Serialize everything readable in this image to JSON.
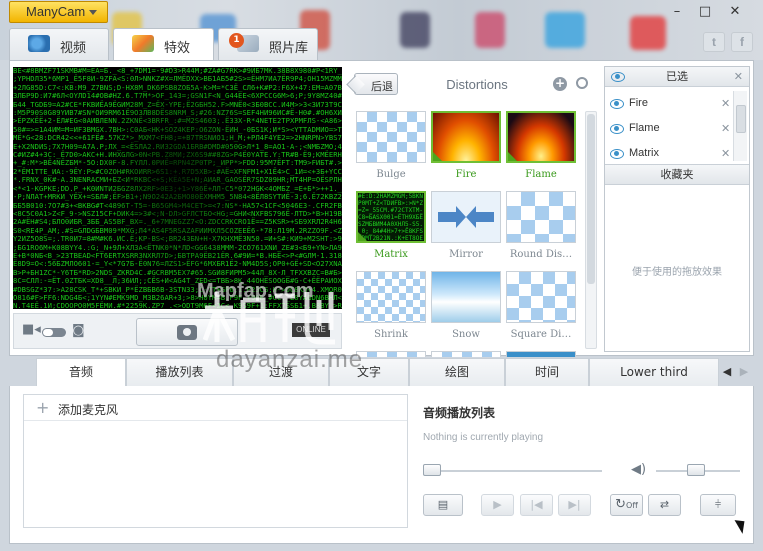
{
  "app": {
    "brand": "ManyCam"
  },
  "window_controls": {
    "min": "–",
    "max": "□",
    "close": "✕"
  },
  "social": {
    "twitter": "t",
    "facebook": "f"
  },
  "main_tabs": [
    {
      "label": "视频"
    },
    {
      "label": "特效"
    },
    {
      "label": "照片库",
      "badge": "1"
    }
  ],
  "effects": {
    "back_label": "后退",
    "category_title": "Distortions",
    "items": [
      {
        "label": "Bulge"
      },
      {
        "label": "Fire"
      },
      {
        "label": "Flame"
      },
      {
        "label": "Matrix"
      },
      {
        "label": "Mirror"
      },
      {
        "label": "Round Dis…"
      },
      {
        "label": "Shrink"
      },
      {
        "label": "Snow"
      },
      {
        "label": "Square Di…"
      }
    ]
  },
  "selected": {
    "header": "已选",
    "items": [
      {
        "label": "Fire"
      },
      {
        "label": "Flame"
      },
      {
        "label": "Matrix"
      }
    ],
    "favorites_header": "收藏夹",
    "favorites_hint": "便于使用的拖放效果"
  },
  "bottom_tabs": [
    {
      "label": "音频"
    },
    {
      "label": "播放列表"
    },
    {
      "label": "过渡"
    },
    {
      "label": "文字"
    },
    {
      "label": "绘图"
    },
    {
      "label": "时间"
    },
    {
      "label": "Lower third"
    }
  ],
  "audio": {
    "add_mic": "添加麦克风",
    "playlist_title": "音频播放列表",
    "status": "Nothing is currently playing",
    "off_label": "Off"
  },
  "watermark": {
    "site": "Mapfap.com",
    "url": "dayanzai.me",
    "brand_text": "ONLINE"
  }
}
